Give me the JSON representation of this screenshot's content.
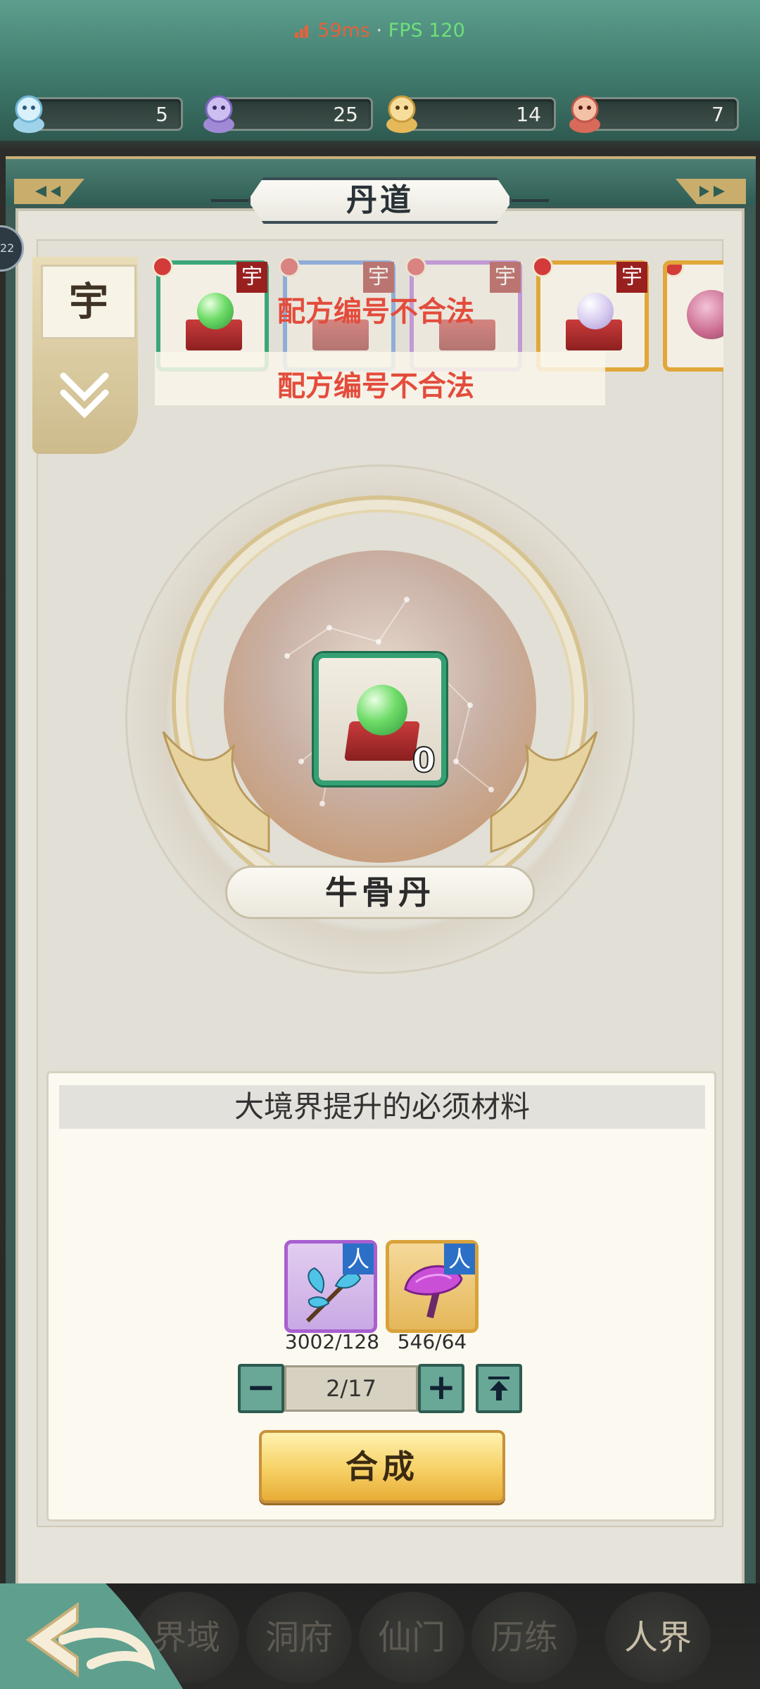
{
  "status": {
    "ping": "59ms",
    "separator": "·",
    "fps": "FPS 120"
  },
  "resources": [
    {
      "icon": "blue-spirit-icon",
      "value": "5"
    },
    {
      "icon": "purple-spirit-icon",
      "value": "25"
    },
    {
      "icon": "gold-spirit-icon",
      "value": "14"
    },
    {
      "icon": "red-spirit-icon",
      "value": "7"
    }
  ],
  "side_pill": "22",
  "panel": {
    "title": "丹道",
    "grade_tab": "宇"
  },
  "recipes": [
    {
      "tag": "宇",
      "frame": "green"
    },
    {
      "tag": "宇",
      "frame": "blue"
    },
    {
      "tag": "宇",
      "frame": "purple"
    },
    {
      "tag": "宇",
      "frame": "gold"
    },
    {
      "tag": "",
      "frame": "gold"
    }
  ],
  "errors": [
    "配方编号不合法",
    "配方编号不合法"
  ],
  "selected_item": {
    "name": "牛骨丹",
    "count": "0"
  },
  "materials": {
    "header": "大境界提升的必须材料",
    "items": [
      {
        "icon": "blue-herb-icon",
        "badge": "人",
        "count": "3002/128"
      },
      {
        "icon": "purple-mushroom-icon",
        "badge": "人",
        "count": "546/64"
      }
    ]
  },
  "quantity": {
    "minus": "−",
    "value": "2/17",
    "plus": "+"
  },
  "craft_label": "合成",
  "nav": [
    {
      "label": "界域"
    },
    {
      "label": "洞府"
    },
    {
      "label": "仙门"
    },
    {
      "label": "历练"
    },
    {
      "label": "人界"
    }
  ],
  "colors": {
    "accent_teal": "#3d6e63",
    "error_red": "#e34c3c",
    "gold_button": "#f6d064",
    "ping_red": "#e5613c",
    "fps_green": "#6ee07a"
  }
}
